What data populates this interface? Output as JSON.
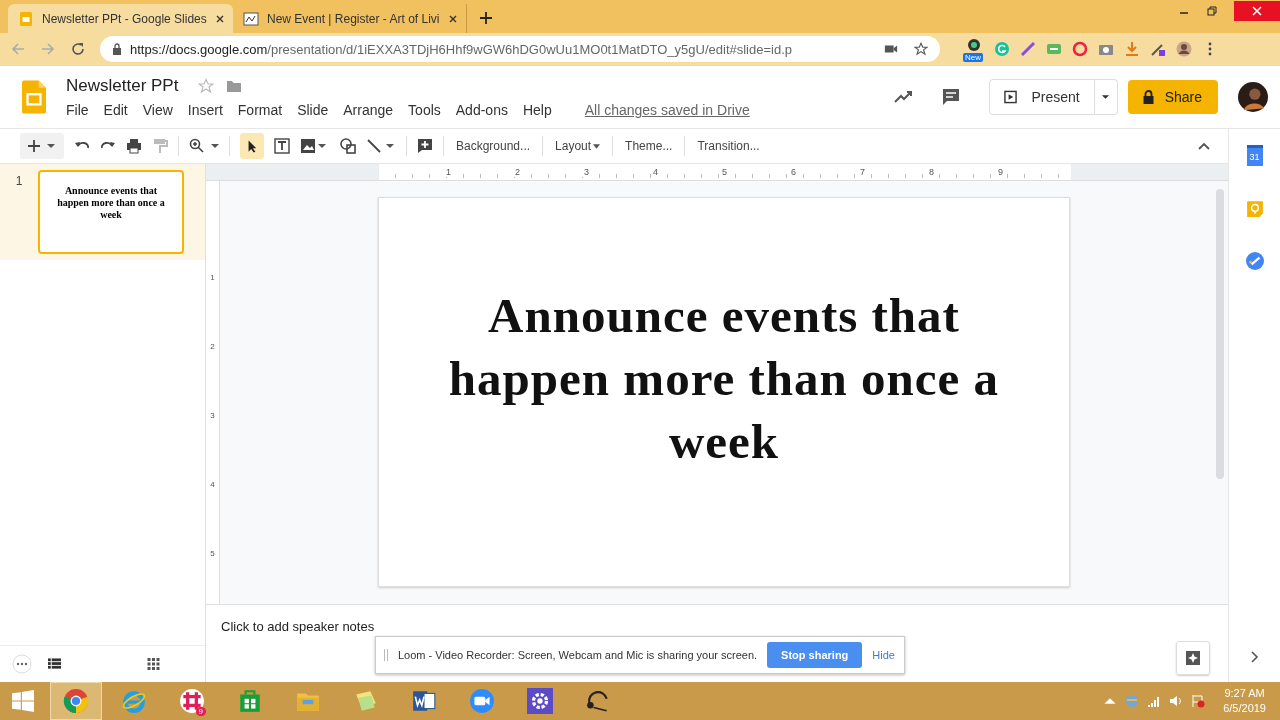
{
  "browser": {
    "tabs": [
      {
        "title": "Newsletter PPt - Google Slides",
        "kind": "slides",
        "selected": true
      },
      {
        "title": "New Event | Register - Art of Livi",
        "kind": "event",
        "selected": false
      }
    ],
    "url_host": "https://docs.google.com",
    "url_path": "/presentation/d/1iEXXA3TDjH6Hhf9wGW6hDG0wUu1MO0t1MatDTO_y5gU/edit#slide=id.p",
    "extension_badge": "New"
  },
  "doc": {
    "title": "Newsletter PPt",
    "menu": [
      "File",
      "Edit",
      "View",
      "Insert",
      "Format",
      "Slide",
      "Arrange",
      "Tools",
      "Add-ons",
      "Help"
    ],
    "save_status": "All changes saved in Drive",
    "present": "Present",
    "share": "Share"
  },
  "toolbar": {
    "text_buttons": [
      {
        "label": "Background...",
        "dropdown": false
      },
      {
        "label": "Layout",
        "dropdown": true
      },
      {
        "label": "Theme...",
        "dropdown": false
      },
      {
        "label": "Transition...",
        "dropdown": false
      }
    ]
  },
  "ruler": {
    "h_labels": [
      "1",
      "2",
      "3",
      "4",
      "5",
      "6",
      "7",
      "8",
      "9"
    ],
    "v_labels": [
      "1",
      "2",
      "3",
      "4",
      "5"
    ]
  },
  "slides": [
    {
      "number": "1",
      "title": "Announce events that happen more than once a week",
      "selected": true
    }
  ],
  "canvas": {
    "slide_title": "Announce events that happen more than once a week"
  },
  "side_panel": {
    "calendar_day": "31"
  },
  "notes": {
    "placeholder": "Click to add speaker notes"
  },
  "loom": {
    "message": "Loom - Video Recorder: Screen, Webcam and Mic is sharing your screen.",
    "stop": "Stop sharing",
    "hide": "Hide"
  },
  "taskbar": {
    "apps": [
      {
        "kind": "chrome",
        "selected": true
      },
      {
        "kind": "ie",
        "selected": false
      },
      {
        "kind": "slack",
        "selected": false,
        "badge": "9"
      },
      {
        "kind": "store",
        "selected": false
      },
      {
        "kind": "files",
        "selected": false
      },
      {
        "kind": "notes",
        "selected": false
      },
      {
        "kind": "word",
        "selected": false
      },
      {
        "kind": "zoom",
        "selected": false
      },
      {
        "kind": "settings",
        "selected": false
      },
      {
        "kind": "headset",
        "selected": false
      }
    ],
    "time": "9:27 AM",
    "date": "6/5/2019"
  }
}
